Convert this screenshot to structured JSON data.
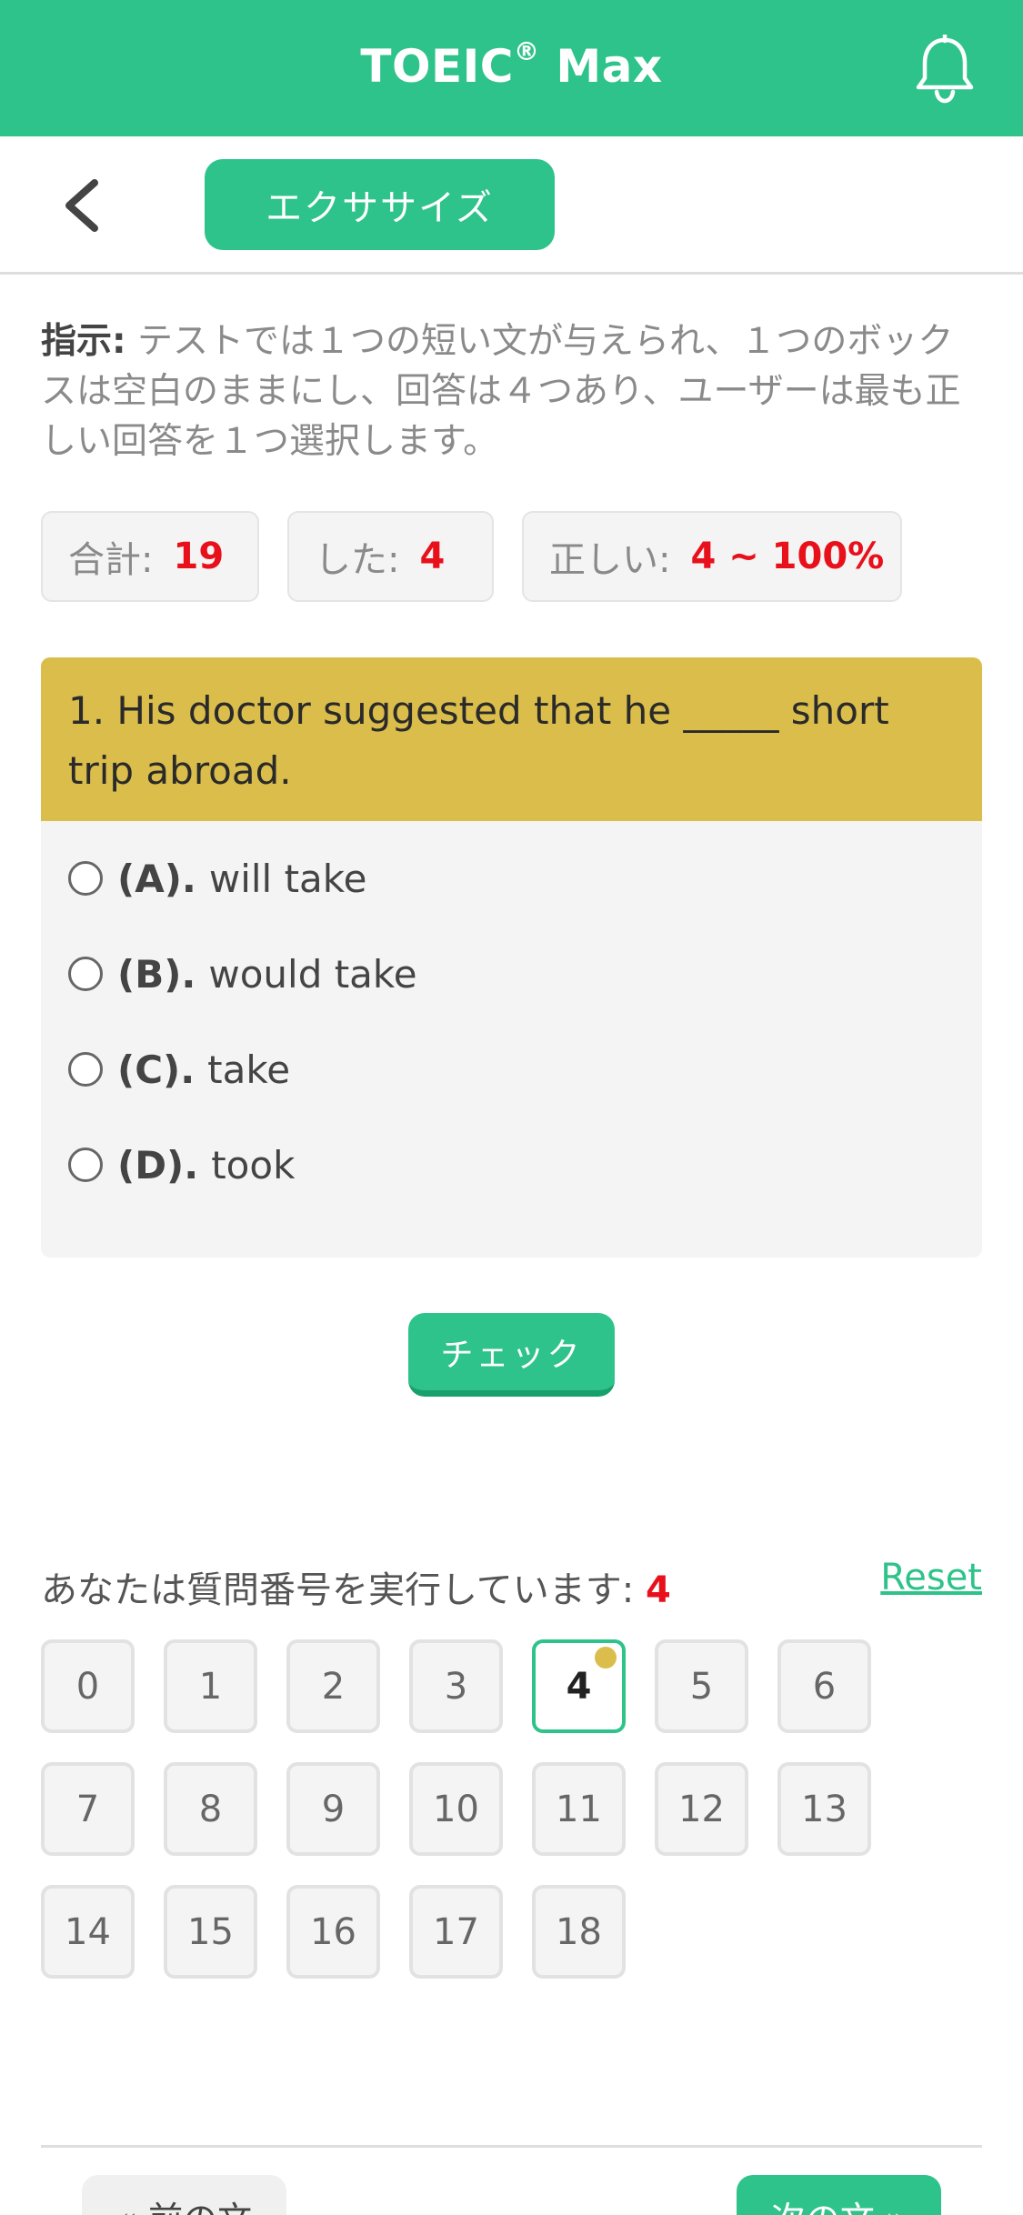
{
  "header": {
    "title": "TOEIC",
    "title_mark": "®",
    "title_suffix": " Max",
    "bell_icon": "bell-icon",
    "color": "#2ec38a"
  },
  "subbar": {
    "back_icon": "chevron-left-icon",
    "tab_label": "エクササイズ"
  },
  "instructions": {
    "label": "指示:",
    "text": " テストでは１つの短い文が与えられ、１つのボックスは空白のままにし、回答は４つあり、ユーザーは最も正しい回答を１つ選択します。"
  },
  "stats": [
    {
      "label": "合計:",
      "value": "19"
    },
    {
      "label": "した:",
      "value": "4"
    },
    {
      "label": "正しい:",
      "value": "4 ~ 100%"
    }
  ],
  "question": {
    "text": "1. His doctor suggested that he _____ short trip abroad.",
    "options": [
      {
        "letter": "(A).",
        "text": "will take"
      },
      {
        "letter": "(B).",
        "text": "would take"
      },
      {
        "letter": "(C).",
        "text": "take"
      },
      {
        "letter": "(D).",
        "text": "took"
      }
    ]
  },
  "check_label": "チェック",
  "navigator": {
    "running_label": "あなたは質問番号を実行しています: ",
    "current": "4",
    "reset_label": "Reset",
    "numbers": [
      "0",
      "1",
      "2",
      "3",
      "4",
      "5",
      "6",
      "7",
      "8",
      "9",
      "10",
      "11",
      "12",
      "13",
      "14",
      "15",
      "16",
      "17",
      "18"
    ]
  },
  "footer": {
    "prev_label": "« 前の文",
    "next_label": "次の文 »"
  }
}
